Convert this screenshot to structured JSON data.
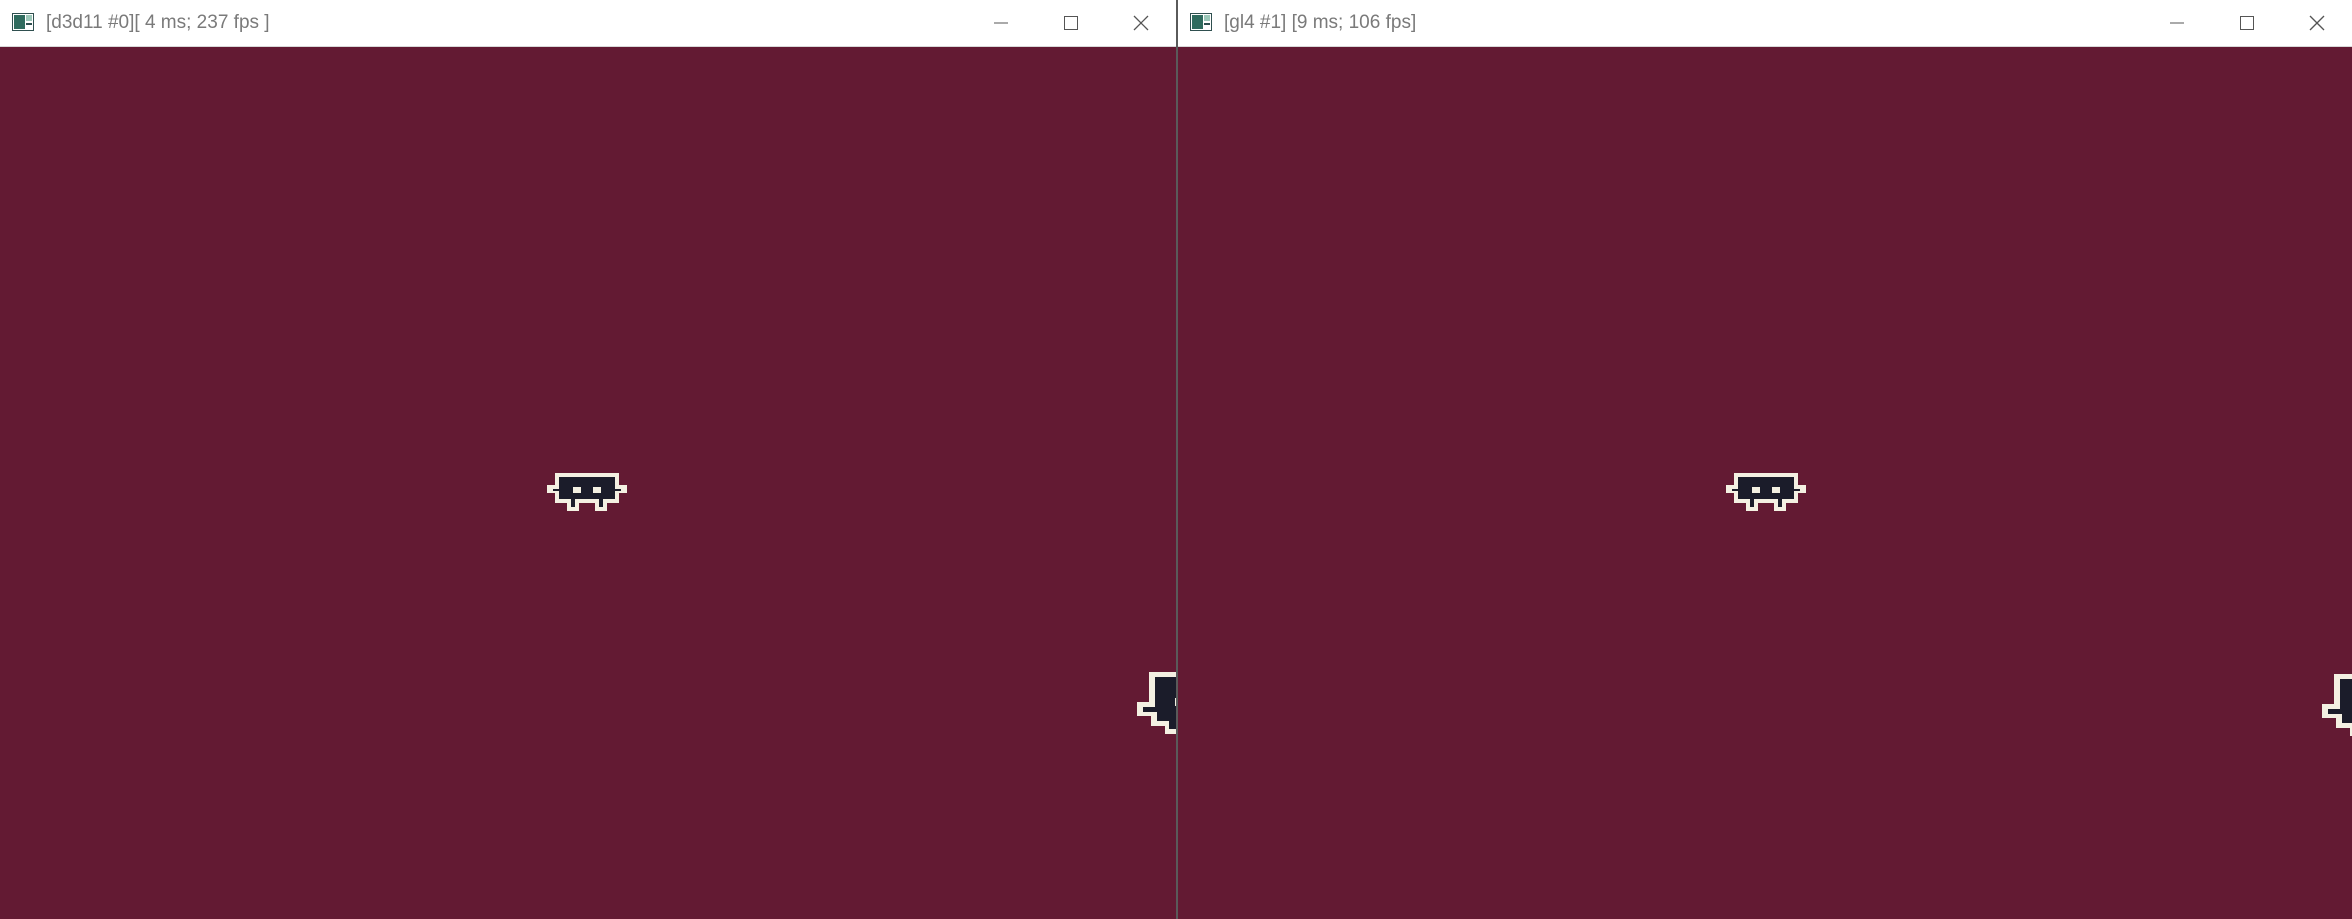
{
  "windows": [
    {
      "title": "[d3d11 #0][ 4 ms; 237 fps ]",
      "controls": [
        "minimize-icon",
        "maximize-icon",
        "close-icon"
      ]
    },
    {
      "title": "[gl4 #1] [9 ms; 106 fps]",
      "controls": [
        "minimize-icon",
        "maximize-icon",
        "close-icon"
      ]
    }
  ],
  "colors": {
    "viewport_background": "#631a33",
    "sprite_body": "#1b1c2a",
    "sprite_outline": "#f4f0e2",
    "titlebar": "#ffffff",
    "title_text": "#7a7a7a"
  }
}
